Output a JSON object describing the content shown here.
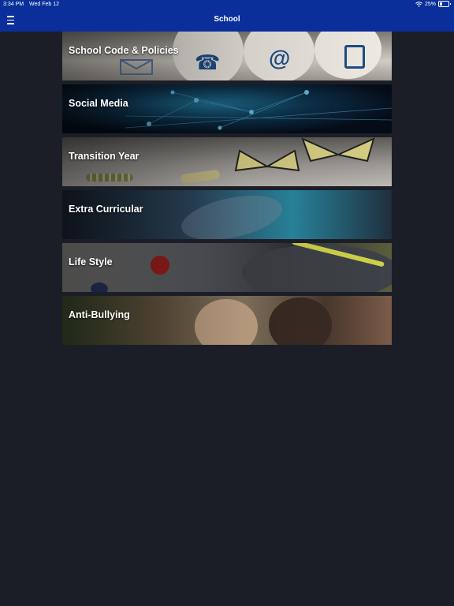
{
  "status_bar": {
    "time": "3:34 PM",
    "date": "Wed Feb 12",
    "battery": "25%",
    "battery_level": 0.25
  },
  "nav": {
    "title": "School",
    "menu_icon": "hamburger-menu-icon"
  },
  "tiles": [
    {
      "label": "School Code & Policies",
      "art": "envelope-phone-at-tablet-icons"
    },
    {
      "label": "Social Media",
      "art": "network-graph"
    },
    {
      "label": "Transition Year",
      "art": "caterpillar-butterflies"
    },
    {
      "label": "Extra Curricular",
      "art": "running-person"
    },
    {
      "label": "Life Style",
      "art": "sneakers-berries"
    },
    {
      "label": "Anti-Bullying",
      "art": "two-teens"
    }
  ],
  "colors": {
    "header": "#0a2f9a",
    "background": "#1c1e27"
  }
}
